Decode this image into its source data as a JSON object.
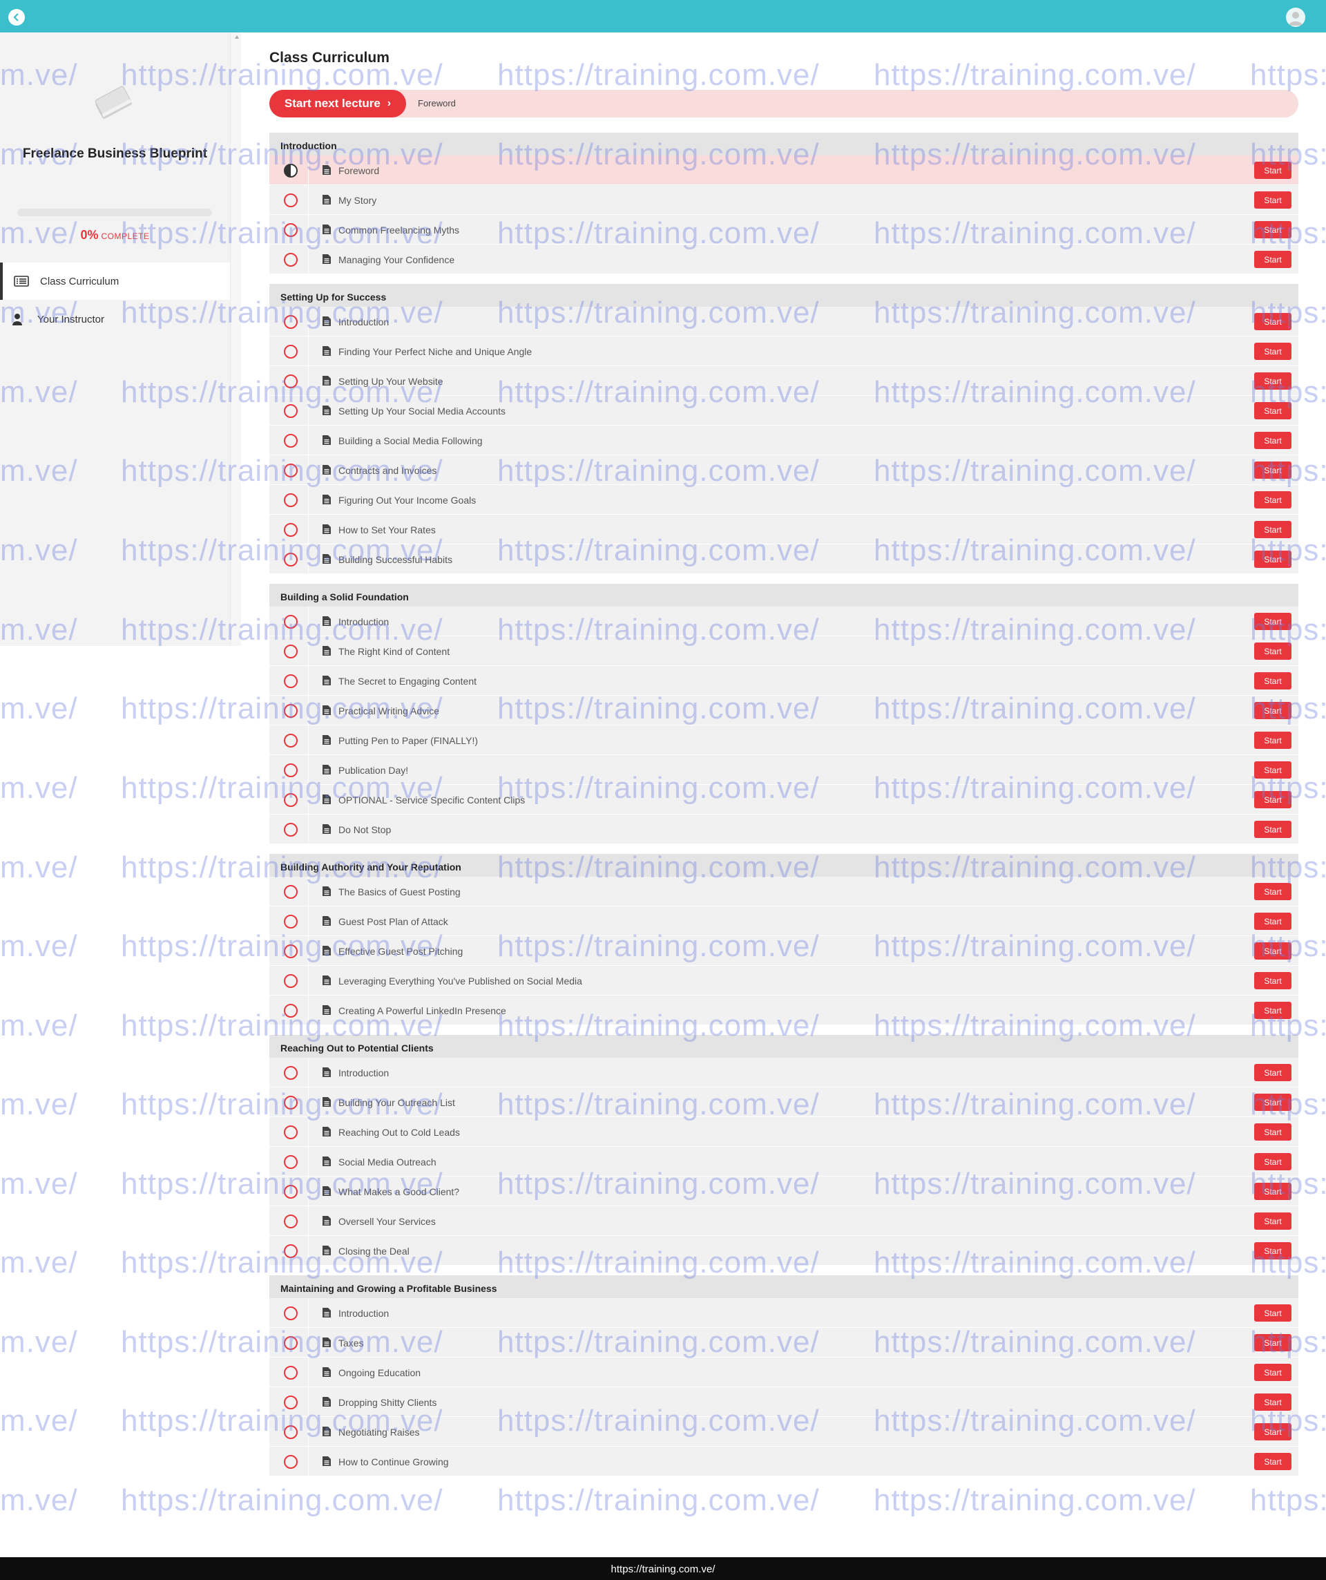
{
  "sidebar": {
    "course_title": "Freelance Business Blueprint",
    "progress_percent": 0,
    "progress_label": "0%",
    "progress_word": "COMPLETE",
    "nav": [
      {
        "label": "Class Curriculum",
        "icon": "list-icon",
        "active": true
      },
      {
        "label": "Your Instructor",
        "icon": "person-icon",
        "active": false
      }
    ]
  },
  "main": {
    "title": "Class Curriculum",
    "next_button_label": "Start next lecture",
    "next_lecture_title": "Foreword"
  },
  "curriculum": {
    "start_label": "Start",
    "sections": [
      {
        "title": "Introduction",
        "items": [
          "Foreword",
          "My Story",
          "Common Freelancing Myths",
          "Managing Your Confidence"
        ]
      },
      {
        "title": "Setting Up for Success",
        "items": [
          "Introduction",
          "Finding Your Perfect Niche and Unique Angle",
          "Setting Up Your Website",
          "Setting Up Your Social Media Accounts",
          "Building a Social Media Following",
          "Contracts and Invoices",
          "Figuring Out Your Income Goals",
          "How to Set Your Rates",
          "Building Successful Habits"
        ]
      },
      {
        "title": "Building a Solid Foundation",
        "items": [
          "Introduction",
          "The Right Kind of Content",
          "The Secret to Engaging Content",
          "Practical Writing Advice",
          "Putting Pen to Paper (FINALLY!)",
          "Publication Day!",
          "OPTIONAL - Service Specific Content Clips",
          "Do Not Stop"
        ]
      },
      {
        "title": "Building Authority and Your Reputation",
        "items": [
          "The Basics of Guest Posting",
          "Guest Post Plan of Attack",
          "Effective Guest Post Pitching",
          "Leveraging Everything You've Published on Social Media",
          "Creating A Powerful LinkedIn Presence"
        ]
      },
      {
        "title": "Reaching Out to Potential Clients",
        "items": [
          "Introduction",
          "Building Your Outreach List",
          "Reaching Out to Cold Leads",
          "Social Media Outreach",
          "What Makes a Good Client?",
          "Oversell Your Services",
          "Closing the Deal"
        ]
      },
      {
        "title": "Maintaining and Growing a Profitable Business",
        "items": [
          "Introduction",
          "Taxes",
          "Ongoing Education",
          "Dropping Shitty Clients",
          "Negotiating Raises",
          "How to Continue Growing"
        ]
      }
    ]
  },
  "watermark_text": "https://training.com.ve/",
  "watermark_edge_left": "m.ve/",
  "watermark_edge_right": "https:",
  "footer_url": "https://training.com.ve/",
  "colors": {
    "topbar": "#3bbfcc",
    "accent": "#e8363c",
    "current_row": "#f9dcdc"
  }
}
